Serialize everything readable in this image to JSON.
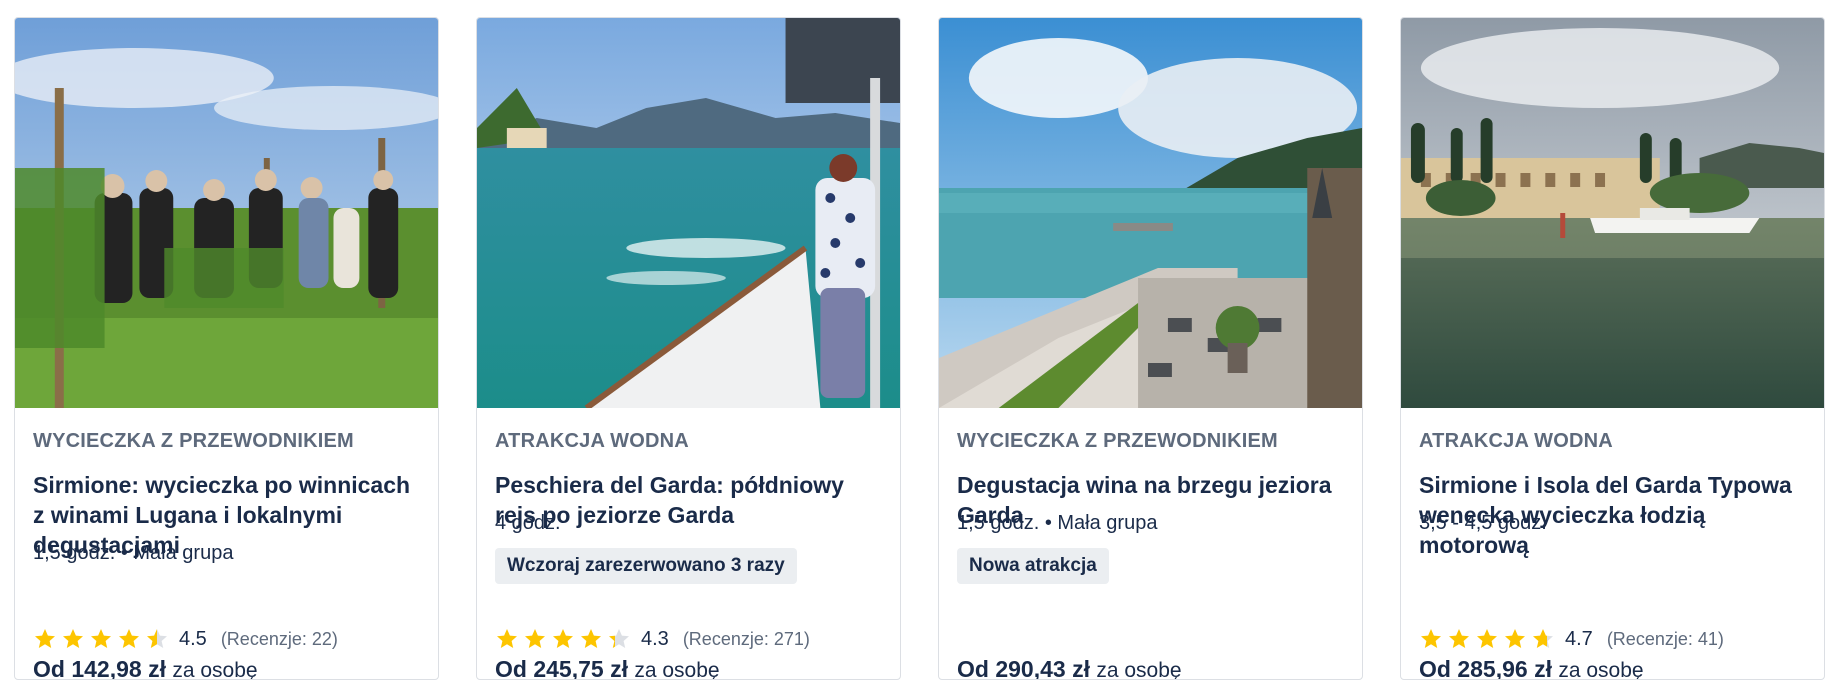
{
  "cards": [
    {
      "category": "WYCIECZKA Z PRZEWODNIKIEM",
      "title": "Sirmione: wycieczka po winnicach z winami Lugana i lokalnymi degustacjami",
      "meta": "1,5 godz. • Mała grupa",
      "rating": "4.5",
      "rating_fraction": 0.9,
      "reviews": "(Recenzje: 22)",
      "price": "Od 142,98 zł",
      "price_unit": "za osobę"
    },
    {
      "category": "ATRAKCJA WODNA",
      "title": "Peschiera del Garda: półdniowy rejs po jeziorze Garda",
      "meta": "4 godz.",
      "badge": "Wczoraj zarezerwowano 3 razy",
      "rating": "4.3",
      "rating_fraction": 0.86,
      "reviews": "(Recenzje: 271)",
      "price": "Od 245,75 zł",
      "price_unit": "za osobę"
    },
    {
      "category": "WYCIECZKA Z PRZEWODNIKIEM",
      "title": "Degustacja wina na brzegu jeziora Garda",
      "meta": "1,5 godz. • Mała grupa",
      "badge": "Nowa atrakcja",
      "price": "Od 290,43 zł",
      "price_unit": "za osobę"
    },
    {
      "category": "ATRAKCJA WODNA",
      "title": "Sirmione i Isola del Garda Typowa wenecka wycieczka łodzią motorową",
      "meta": "3,5 - 4,5 godz.",
      "rating": "4.7",
      "rating_fraction": 0.94,
      "reviews": "(Recenzje: 41)",
      "price": "Od 285,96 zł",
      "price_unit": "za osobę"
    }
  ],
  "colors": {
    "star": "#fdc500",
    "star_empty": "#dcdfe4",
    "text": "#1a2b49",
    "muted": "#5e6a7c"
  }
}
